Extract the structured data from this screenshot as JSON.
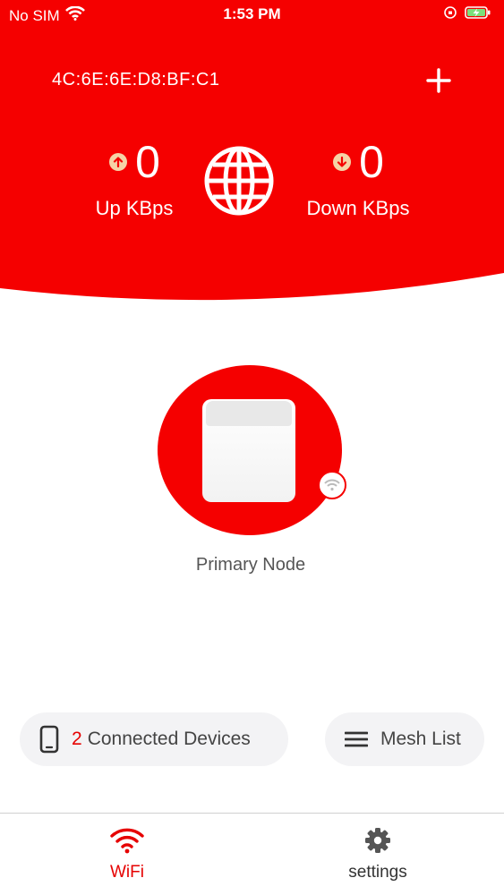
{
  "status_bar": {
    "carrier": "No SIM",
    "time": "1:53 PM"
  },
  "header": {
    "mac_address": "4C:6E:6E:D8:BF:C1",
    "upload": {
      "value": "0",
      "label": "Up KBps"
    },
    "download": {
      "value": "0",
      "label": "Down KBps"
    }
  },
  "node": {
    "label": "Primary Node"
  },
  "actions": {
    "devices_count": "2",
    "devices_label": "Connected Devices",
    "mesh_label": "Mesh List"
  },
  "tabs": [
    {
      "label": "WiFi",
      "active": true
    },
    {
      "label": "settings",
      "active": false
    }
  ],
  "colors": {
    "brand": "#f50000",
    "text": "#444444"
  },
  "icons": {
    "wifi": "wifi-icon",
    "add": "plus-icon",
    "globe": "globe-icon",
    "up": "arrow-up-icon",
    "down": "arrow-down-icon",
    "phone": "phone-icon",
    "menu": "menu-icon",
    "gear": "gear-icon"
  }
}
